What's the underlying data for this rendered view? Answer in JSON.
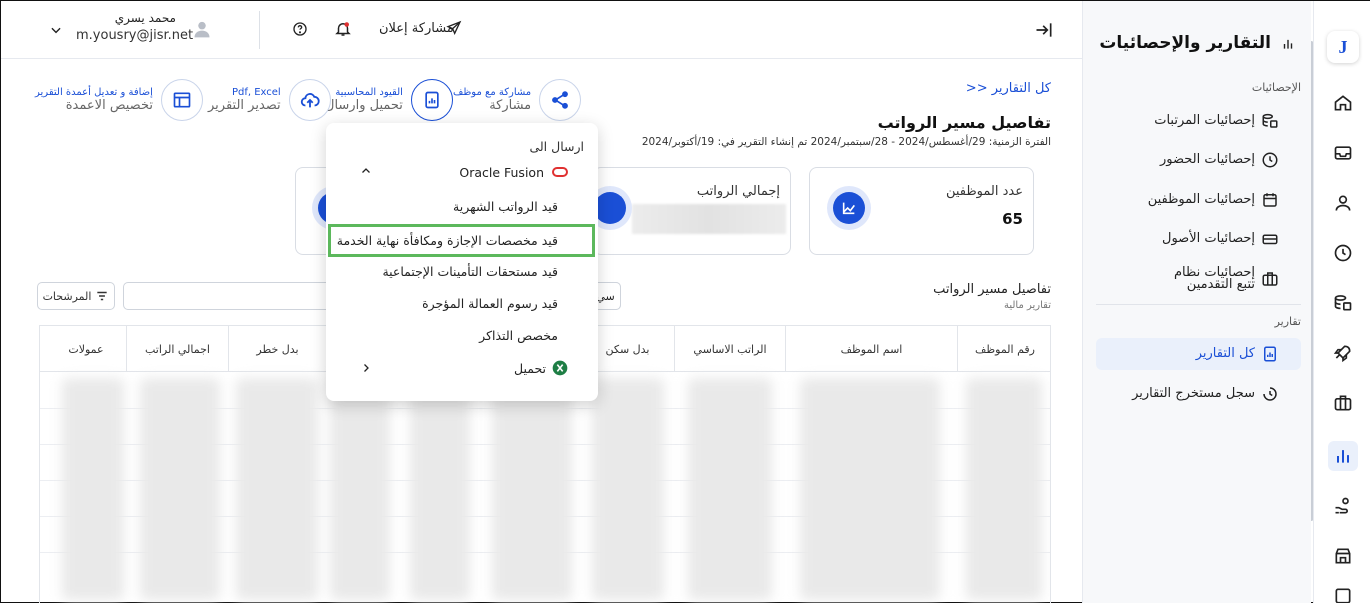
{
  "topbar": {
    "user_name": "محمد يسري",
    "user_email": "m.yousry@jisr.net",
    "share_announcement": "مشاركة إعلان"
  },
  "nav": {
    "title": "التقارير والإحصائيات",
    "section_stats": "الإحصائيات",
    "items": [
      "إحصائيات المرتبات",
      "إحصائيات الحضور",
      "إحصائيات الموظفين",
      "إحصائيات الأصول",
      "إحصائيات نظام تتبع التقدمين"
    ],
    "section_reports": "تقارير",
    "report_items": [
      "كل التقارير",
      "سجل مستخرج التقارير"
    ]
  },
  "main": {
    "back_link": ">> كل التقارير",
    "title": "تفاصيل مسير الرواتب",
    "period": "الفترة الزمنية: 29/أغسطس/2024 - 28/سبتمبر/2024 تم إنشاء التقرير في: 19/أكتوبر/2024",
    "actions": [
      {
        "top": "مشاركة مع موظف",
        "bottom": "مشاركة"
      },
      {
        "top": "القيود المحاسبية",
        "bottom": "تحميل وارسال"
      },
      {
        "top": "Pdf, Excel",
        "bottom": "تصدير التقرير"
      },
      {
        "top": "إضافة و تعديل أعمدة التقرير",
        "bottom": "تخصيص الاعمدة"
      }
    ],
    "cards": {
      "employees_label": "عدد الموظفين",
      "employees_value": "65",
      "salaries_label": "إجمالي الرواتب"
    },
    "section_title": "تفاصيل مسير الرواتب",
    "section_sub": "تقارير مالية",
    "filters_label": "المرشحات",
    "search_partial": "م",
    "search_right_partial": "سي"
  },
  "table": {
    "headers": [
      "رقم الموظف",
      "اسم الموظف",
      "الراتب الاساسي",
      "بدل سكن",
      "",
      "",
      "",
      "بدل خطر",
      "اجمالي الراتب",
      "عمولات"
    ]
  },
  "dropdown": {
    "send_to": "ارسال الى",
    "oracle": "Oracle Fusion",
    "items": [
      "قيد الرواتب الشهرية",
      "قيد مخصصات الإجازة ومكافأة نهاية الخدمة",
      "قيد مستحقات التأمينات الإجتماعية",
      "قيد رسوم العمالة المؤجرة",
      "مخصص التذاكر"
    ],
    "download": "تحميل"
  },
  "colors": {
    "accent": "#1a4fd6",
    "highlight": "#5cb85c",
    "oracle": "#e03131",
    "excel": "#1e7e45"
  }
}
